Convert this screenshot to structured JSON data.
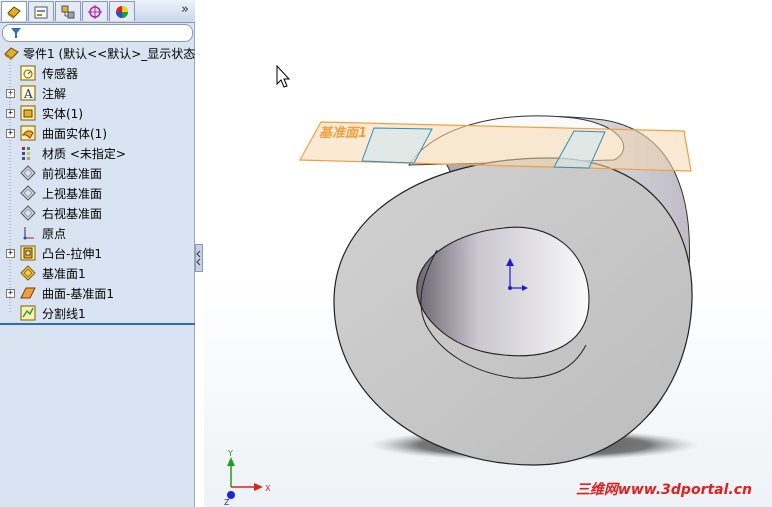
{
  "panel": {
    "tabs": [
      "feature-manager",
      "property-manager",
      "configuration-manager",
      "dimxpert-manager",
      "display-manager"
    ],
    "more": "»",
    "filter_icon": "filter-icon"
  },
  "tree": {
    "items": [
      {
        "label": "零件1  (默认<<默认>_显示状态",
        "icon": "part-icon",
        "expand": ""
      },
      {
        "label": "传感器",
        "icon": "sensor-icon",
        "expand": ""
      },
      {
        "label": "注解",
        "icon": "annotation-icon",
        "expand": "+"
      },
      {
        "label": "实体(1)",
        "icon": "solid-body-icon",
        "expand": "+"
      },
      {
        "label": "曲面实体(1)",
        "icon": "surface-body-icon",
        "expand": "+"
      },
      {
        "label": "材质 <未指定>",
        "icon": "material-icon",
        "expand": ""
      },
      {
        "label": "前视基准面",
        "icon": "plane-icon",
        "expand": ""
      },
      {
        "label": "上视基准面",
        "icon": "plane-icon",
        "expand": ""
      },
      {
        "label": "右视基准面",
        "icon": "plane-icon",
        "expand": ""
      },
      {
        "label": "原点",
        "icon": "origin-icon",
        "expand": ""
      },
      {
        "label": "凸台-拉伸1",
        "icon": "boss-extrude-icon",
        "expand": "+"
      },
      {
        "label": "基准面1",
        "icon": "plane-icon",
        "expand": ""
      },
      {
        "label": "曲面-基准面1",
        "icon": "planar-surface-icon",
        "expand": "+"
      },
      {
        "label": "分割线1",
        "icon": "split-line-icon",
        "expand": ""
      }
    ]
  },
  "viewport": {
    "plane_label": "基准面1",
    "triad": {
      "x": "X",
      "y": "Y",
      "z": "Z"
    },
    "watermark": "三维网www.3dportal.cn",
    "colors": {
      "plane": "#f0a040",
      "part": "#c9c9c9",
      "triad_x": "#e02020",
      "triad_y": "#20a020",
      "triad_z": "#2020e0"
    }
  }
}
